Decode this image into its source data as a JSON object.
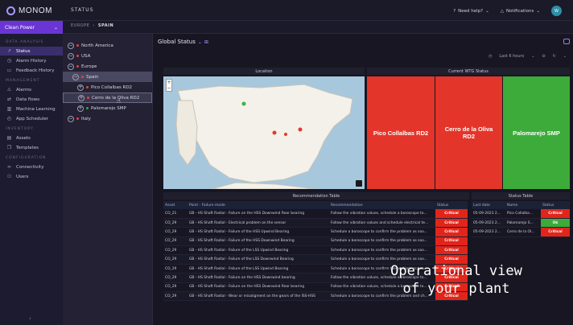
{
  "app": {
    "logo_text": "MONOM",
    "title": "STATUS",
    "help_label": "Need help?",
    "notifications_label": "Notifications",
    "user_initial": "W"
  },
  "site_selector": {
    "value": "Clean Power"
  },
  "breadcrumb": [
    "EUROPE",
    "SPAIN"
  ],
  "sidebar": {
    "sections": [
      {
        "title": "DATA ANALYSIS",
        "items": [
          {
            "label": "Status",
            "icon": "trend-icon",
            "active": true
          },
          {
            "label": "Alarm History",
            "icon": "clock-icon",
            "active": false
          },
          {
            "label": "Feedback History",
            "icon": "comment-icon",
            "active": false
          }
        ]
      },
      {
        "title": "MANAGEMENT",
        "items": [
          {
            "label": "Alarms",
            "icon": "warning-icon",
            "active": false
          },
          {
            "label": "Data flows",
            "icon": "flow-icon",
            "active": false
          },
          {
            "label": "Machine Learning",
            "icon": "chart-icon",
            "active": false
          },
          {
            "label": "App Scheduler",
            "icon": "schedule-icon",
            "active": false
          }
        ]
      },
      {
        "title": "INVENTORY",
        "items": [
          {
            "label": "Assets",
            "icon": "asset-icon",
            "active": false
          },
          {
            "label": "Templates",
            "icon": "template-icon",
            "active": false
          }
        ]
      },
      {
        "title": "CONFIGURATION",
        "items": [
          {
            "label": "Connectivity",
            "icon": "link-icon",
            "active": false
          },
          {
            "label": "Users",
            "icon": "users-icon",
            "active": false
          }
        ]
      }
    ]
  },
  "tree": [
    {
      "label": "North America",
      "level": 0,
      "dot": "#e0463c"
    },
    {
      "label": "USA",
      "level": 0,
      "dot": "#e0463c"
    },
    {
      "label": "Europe",
      "level": 0,
      "dot": "#e0463c"
    },
    {
      "label": "Spain",
      "level": 1,
      "dot": "#e0463c",
      "selected": true
    },
    {
      "label": "Pico Collalbas RD2",
      "level": 2,
      "dot": "#e0463c"
    },
    {
      "label": "Cerro de la Oliva RD2",
      "level": 2,
      "dot": "#e0463c",
      "focused": true
    },
    {
      "label": "Palomarejo SMP",
      "level": 2,
      "dot": "#3ca64a"
    },
    {
      "label": "Italy",
      "level": 0,
      "dot": "#e0463c"
    }
  ],
  "main": {
    "title": "Global Status",
    "time_filter": "Last 6 hours",
    "location_title": "Location",
    "wtg_title": "Current WTG Status",
    "zoom_in": "+",
    "zoom_out": "−",
    "tiles": [
      {
        "name": "Pico Collalbas RD2",
        "color": "#e4352a"
      },
      {
        "name": "Cerro de la Oliva RD2",
        "color": "#e4352a"
      },
      {
        "name": "Palomarejo SMP",
        "color": "#3cab3a"
      }
    ]
  },
  "recommendation_table": {
    "title": "Recommendation Table",
    "columns": [
      "Asset",
      "Point - Failure mode",
      "Recommendation",
      "Status"
    ],
    "rows": [
      {
        "asset": "CO_21",
        "failure": "GB - HS Shaft Radial - Failure on the HSS Downwind Rear bearing",
        "rec": "Follow the vibration values, schedule a boroscope to...",
        "status": "Critical"
      },
      {
        "asset": "CO_29",
        "failure": "GB - HS Shaft Radial - Electrical problem on the sensor",
        "rec": "Follow the vibration values and schedule electrical te...",
        "status": "Critical"
      },
      {
        "asset": "CO_29",
        "failure": "GB - HS Shaft Radial - Failure of the HSS Upwind Bearing",
        "rec": "Schedule a boroscope to confirm the problem as soo...",
        "status": "Critical"
      },
      {
        "asset": "CO_29",
        "failure": "GB - HS Shaft Radial - Failure of the HSS Downwind Bearing",
        "rec": "Schedule a boroscope to confirm the problem as soo...",
        "status": "Critical"
      },
      {
        "asset": "CO_29",
        "failure": "GB - HS Shaft Radial - Failure of the LSS Upwind Bearing",
        "rec": "Schedule a boroscope to confirm the problem as soo...",
        "status": "Critical"
      },
      {
        "asset": "CO_29",
        "failure": "GB - HS Shaft Radial - Failure of the LSS Downwind Bearing",
        "rec": "Schedule a boroscope to confirm the problem as soo...",
        "status": "Critical"
      },
      {
        "asset": "CO_29",
        "failure": "GB - HS Shaft Radial - Failure of the LSS Upwind Bearing",
        "rec": "Schedule a boroscope to confirm the problem as soo...",
        "status": "Critical"
      },
      {
        "asset": "CO_29",
        "failure": "GB - HS Shaft Radial - Failure on the HSS Downwind bearing",
        "rec": "Follow the vibration values, schedule a boroscope to...",
        "status": "Critical"
      },
      {
        "asset": "CO_29",
        "failure": "GB - HS Shaft Radial - Failure on the HSS Downwind Rear bearing",
        "rec": "Follow the vibration values, schedule a boroscope to...",
        "status": "Critical"
      },
      {
        "asset": "CO_29",
        "failure": "GB - HS Shaft Radial - Wear or misaligment on the gears of the ISS-HSS",
        "rec": "Schedule a boroscope to confirm the problem and ch...",
        "status": "Critical"
      }
    ]
  },
  "status_table": {
    "title": "Status Table",
    "columns": [
      "Last date",
      "Name",
      "Status"
    ],
    "rows": [
      {
        "date": "05-09-2023 2...",
        "name": "Pico Collalba...",
        "status": "Critical"
      },
      {
        "date": "05-09-2023 2...",
        "name": "Palomarejo S...",
        "status": "Ok"
      },
      {
        "date": "05-09-2023 2...",
        "name": "Cerro de la Ol...",
        "status": "Critical"
      }
    ]
  },
  "status_colors": {
    "Critical": "#e1251b",
    "Ok": "#3cab3a"
  },
  "overlay": {
    "line1": "Operational view",
    "line2": "of your plant"
  }
}
